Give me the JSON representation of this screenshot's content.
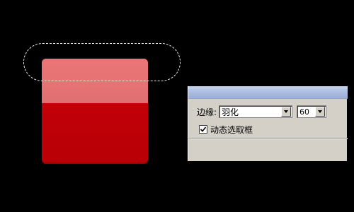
{
  "options_panel": {
    "feather_label": "边缘:",
    "feather_mode": "羽化",
    "feather_value": "60",
    "animated_marquee_label": "动态选取框",
    "animated_marquee_checked": true
  },
  "colors": {
    "background": "#000000",
    "button_red": "#c20008",
    "button_highlight": "#e57274",
    "panel_bg": "#d4d0c8",
    "titlebar": "#a7b9dd"
  },
  "icons": {
    "checkbox": "check-mark-icon",
    "dropdown": "triangle-down-icon"
  }
}
